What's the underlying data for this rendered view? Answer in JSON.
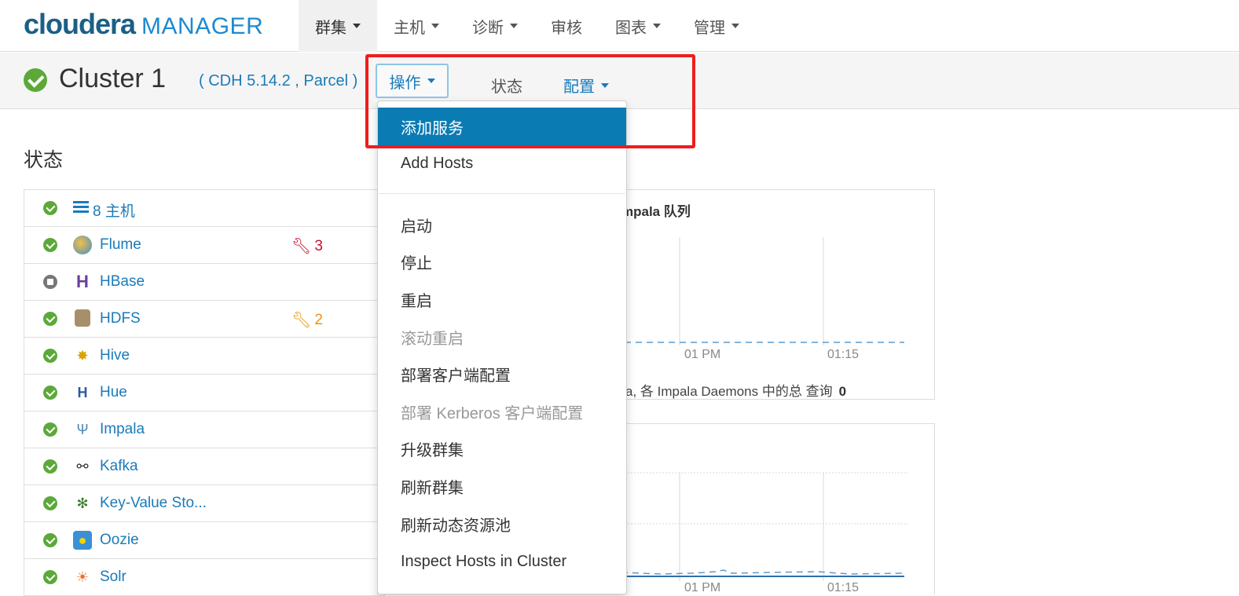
{
  "logo": {
    "brand": "cloudera",
    "product": "MANAGER"
  },
  "nav": [
    {
      "label": "群集",
      "caret": true,
      "active": true
    },
    {
      "label": "主机",
      "caret": true
    },
    {
      "label": "诊断",
      "caret": true
    },
    {
      "label": "审核",
      "caret": false
    },
    {
      "label": "图表",
      "caret": true
    },
    {
      "label": "管理",
      "caret": true
    }
  ],
  "cluster": {
    "name": "Cluster 1",
    "version": "( CDH 5.14.2 , Parcel )",
    "actions_label": "操作",
    "status_label": "状态",
    "config_label": "配置"
  },
  "status_section": {
    "title": "状态",
    "rows": [
      {
        "name": "8 主机",
        "status": "good",
        "icon": "hosts-list-icon"
      },
      {
        "name": "Flume",
        "status": "good",
        "icon": "flume-icon",
        "alert_count": "3",
        "alert_color": "red"
      },
      {
        "name": "HBase",
        "status": "stopped",
        "icon": "hbase-icon"
      },
      {
        "name": "HDFS",
        "status": "good",
        "icon": "hdfs-icon",
        "alert_count": "2",
        "alert_color": "orange"
      },
      {
        "name": "Hive",
        "status": "good",
        "icon": "hive-icon"
      },
      {
        "name": "Hue",
        "status": "good",
        "icon": "hue-icon"
      },
      {
        "name": "Impala",
        "status": "good",
        "icon": "impala-icon"
      },
      {
        "name": "Kafka",
        "status": "good",
        "icon": "kafka-icon"
      },
      {
        "name": "Key-Value Sto...",
        "status": "good",
        "icon": "key-value-store-icon"
      },
      {
        "name": "Oozie",
        "status": "good",
        "icon": "oozie-icon"
      },
      {
        "name": "Solr",
        "status": "good",
        "icon": "solr-icon"
      }
    ]
  },
  "charts": {
    "impala_title": "mpala 队列",
    "impala_footer": "a, 各 Impala Daemons 中的总 查询",
    "impala_footer_value": "0",
    "x_ticks": [
      "01 PM",
      "01:15"
    ]
  },
  "dropdown": {
    "items": [
      {
        "label": "添加服务",
        "state": "highlight"
      },
      {
        "label": "Add Hosts",
        "state": "normal"
      },
      {
        "label": "启动",
        "state": "normal"
      },
      {
        "label": "停止",
        "state": "normal"
      },
      {
        "label": "重启",
        "state": "normal"
      },
      {
        "label": "滚动重启",
        "state": "disabled"
      },
      {
        "label": "部署客户端配置",
        "state": "normal"
      },
      {
        "label": "部署 Kerberos 客户端配置",
        "state": "disabled"
      },
      {
        "label": "升级群集",
        "state": "normal"
      },
      {
        "label": "刷新群集",
        "state": "normal"
      },
      {
        "label": "刷新动态资源池",
        "state": "normal"
      },
      {
        "label": "Inspect Hosts in Cluster",
        "state": "normal"
      }
    ]
  },
  "colors": {
    "link": "#1a7bb9",
    "good": "#5ca93a",
    "highlight": "#0b7bb3",
    "annotation": "#f01c1c"
  }
}
